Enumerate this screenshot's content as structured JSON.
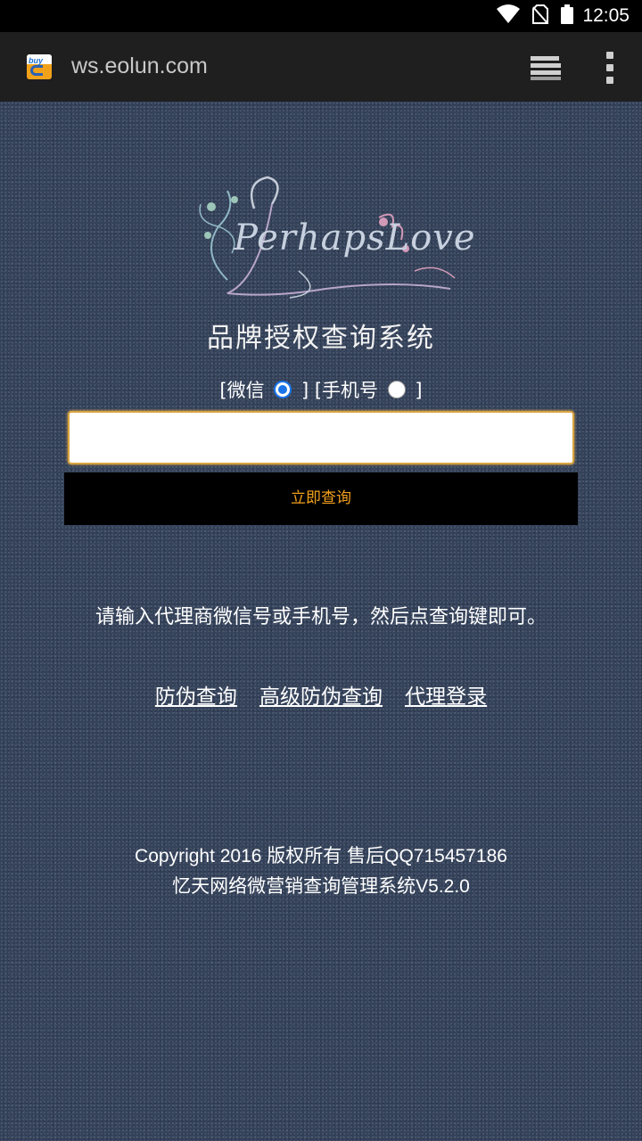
{
  "status_bar": {
    "time": "12:05",
    "icons": [
      "wifi-icon",
      "no-sim-icon",
      "battery-icon"
    ]
  },
  "browser": {
    "url": "ws.eolun.com",
    "favicon_text": "buy",
    "tabs_icon": "tabs-icon",
    "menu_icon": "overflow-menu-icon"
  },
  "brand": {
    "logo_text": "PerhapsLove",
    "system_title": "品牌授权查询系统"
  },
  "search": {
    "option_wechat": "[微信",
    "option_separator": "] [手机号",
    "option_close": "]",
    "selected_option": "微信",
    "input_value": "",
    "button_label": "立即查询"
  },
  "hint": "请输入代理商微信号或手机号，然后点查询键即可。",
  "links": [
    "防伪查询",
    "高级防伪查询",
    "代理登录"
  ],
  "footer": {
    "line1": "Copyright 2016 版权所有 售后QQ715457186",
    "line2": "忆天网络微营销查询管理系统V5.2.0"
  },
  "colors": {
    "button_bg": "#000000",
    "button_text": "#f4a11d",
    "input_border": "#d9a441",
    "page_bg": "#34425a"
  }
}
